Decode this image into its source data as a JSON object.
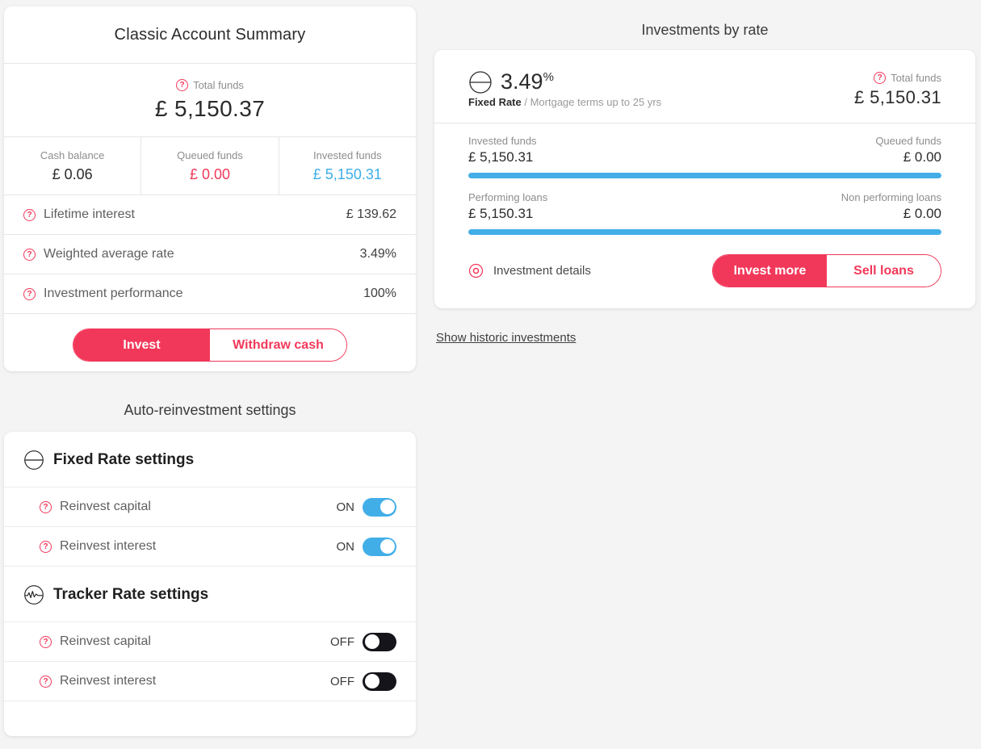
{
  "summary": {
    "title": "Classic Account Summary",
    "total_funds_label": "Total funds",
    "total_funds_value": "£ 5,150.37",
    "columns": [
      {
        "label": "Cash balance",
        "value": "£ 0.06"
      },
      {
        "label": "Queued funds",
        "value": "£ 0.00"
      },
      {
        "label": "Invested funds",
        "value": "£ 5,150.31"
      }
    ],
    "rows": [
      {
        "label": "Lifetime interest",
        "value": "£ 139.62"
      },
      {
        "label": "Weighted average rate",
        "value": "3.49%"
      },
      {
        "label": "Investment performance",
        "value": "100%"
      }
    ],
    "primary_action": "Invest",
    "secondary_action": "Withdraw cash"
  },
  "investments": {
    "heading": "Investments by rate",
    "rate_value": "3.49",
    "rate_unit": "%",
    "rate_name": "Fixed Rate",
    "rate_separator": " / ",
    "rate_terms": "Mortgage terms up to 25 yrs",
    "total_funds_label": "Total funds",
    "total_funds_value": "£ 5,150.31",
    "bars": [
      {
        "left_label": "Invested funds",
        "left_value": "£ 5,150.31",
        "right_label": "Queued funds",
        "right_value": "£ 0.00",
        "fill_percent": 100
      },
      {
        "left_label": "Performing loans",
        "left_value": "£ 5,150.31",
        "right_label": "Non performing loans",
        "right_value": "£ 0.00",
        "fill_percent": 100
      }
    ],
    "details_link": "Investment details",
    "primary_action": "Invest more",
    "secondary_action": "Sell loans",
    "historic_link": "Show historic investments"
  },
  "auto_reinvestment": {
    "heading": "Auto-reinvestment settings",
    "groups": [
      {
        "title": "Fixed Rate settings",
        "icon": "fixed-rate-icon",
        "rows": [
          {
            "label": "Reinvest capital",
            "state_text": "ON",
            "state": "on"
          },
          {
            "label": "Reinvest interest",
            "state_text": "ON",
            "state": "on"
          }
        ]
      },
      {
        "title": "Tracker Rate settings",
        "icon": "tracker-rate-icon",
        "rows": [
          {
            "label": "Reinvest capital",
            "state_text": "OFF",
            "state": "off"
          },
          {
            "label": "Reinvest interest",
            "state_text": "OFF",
            "state": "off"
          }
        ]
      }
    ]
  },
  "icons": {
    "help": "?"
  },
  "colors": {
    "accent_pink": "#f2385a",
    "accent_blue": "#42aee8",
    "value_blue": "#3caee8",
    "page_background": "#f4f4f4",
    "toggle_off": "#14141a"
  }
}
